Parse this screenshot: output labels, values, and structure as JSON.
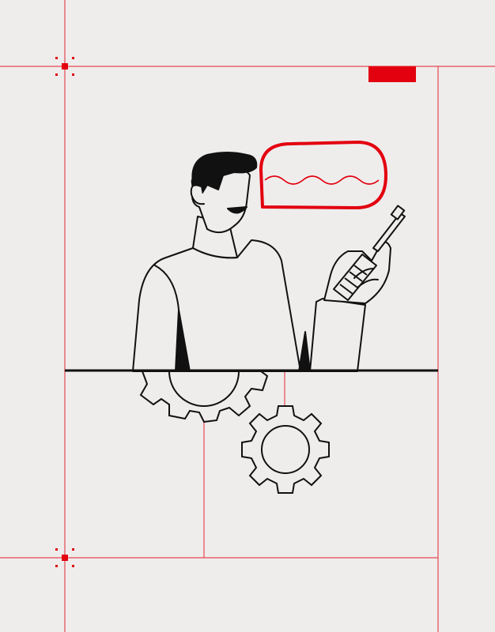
{
  "illustration": {
    "subject": "person-with-screwdriver-and-gears",
    "icons": [
      "speech-bubble-icon",
      "screwdriver-icon",
      "gear-icon",
      "gear-icon"
    ]
  },
  "colors": {
    "background": "#eeedec",
    "accent_red": "#e3000f",
    "ink": "#111111",
    "guide_line": "#e8474f"
  }
}
